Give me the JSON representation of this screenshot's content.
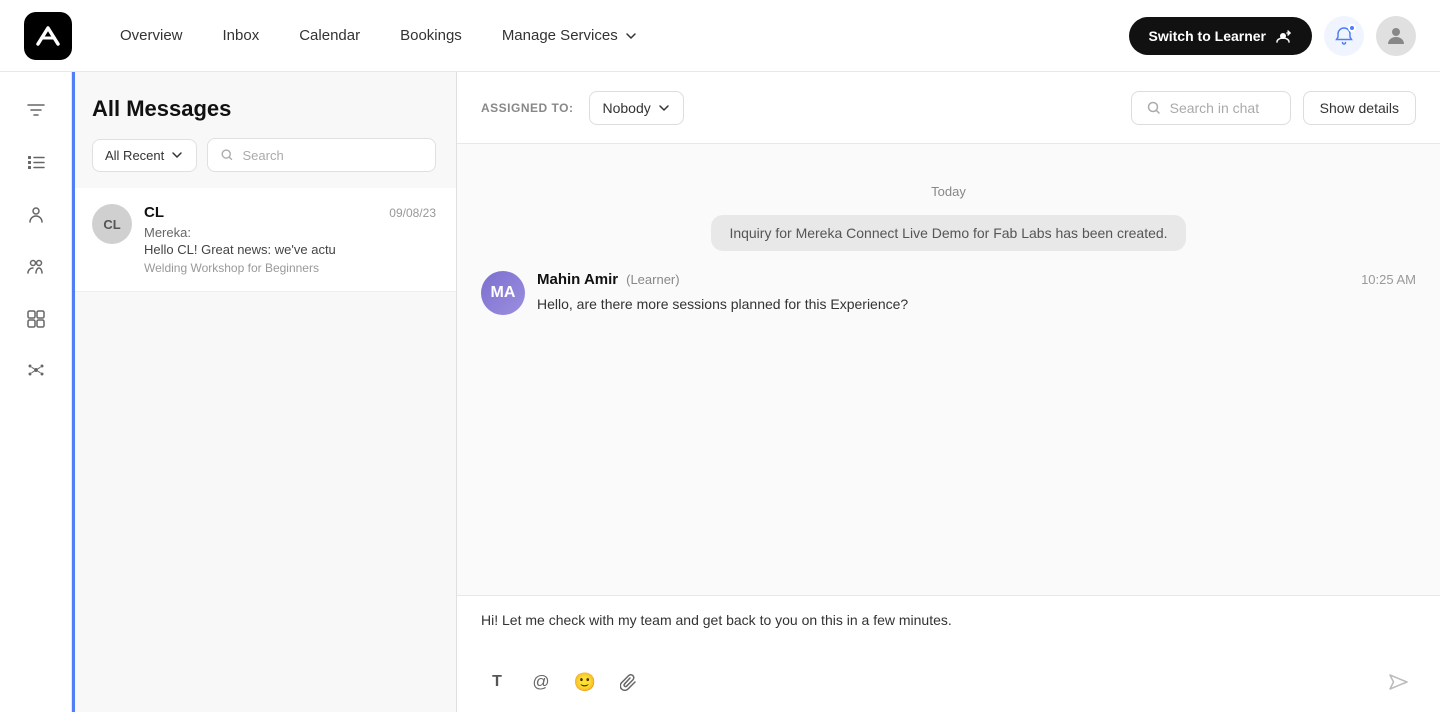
{
  "nav": {
    "overview": "Overview",
    "inbox": "Inbox",
    "calendar": "Calendar",
    "bookings": "Bookings",
    "manage_services": "Manage Services",
    "switch_to_learner": "Switch to Learner"
  },
  "sidebar": {
    "icons": [
      {
        "name": "filter-icon",
        "label": "Filters"
      },
      {
        "name": "list-icon",
        "label": "List"
      },
      {
        "name": "person-icon",
        "label": "Person"
      },
      {
        "name": "group-icon",
        "label": "Group"
      },
      {
        "name": "queue-icon",
        "label": "Queue"
      },
      {
        "name": "molecule-icon",
        "label": "Molecule"
      }
    ]
  },
  "messages_panel": {
    "title": "All Messages",
    "filter_label": "All Recent",
    "search_placeholder": "Search",
    "messages": [
      {
        "initials": "CL",
        "sender": "CL",
        "date": "09/08/23",
        "from": "Mereka:",
        "preview": "Hello CL! Great news: we've actu",
        "subject": "Welding Workshop for Beginners"
      }
    ]
  },
  "chat": {
    "assigned_label": "ASSIGNED TO:",
    "assigned_value": "Nobody",
    "search_chat_placeholder": "Search in chat",
    "show_details_label": "Show details",
    "date_separator": "Today",
    "system_message": "Inquiry for Mereka Connect Live Demo for Fab Labs has been created.",
    "messages": [
      {
        "sender": "Mahin Amir",
        "role": "(Learner)",
        "time": "10:25 AM",
        "text": "Hello, are there more sessions planned for this Experience?",
        "initials": "MA"
      }
    ],
    "input_draft": "Hi! Let me check with my team and get back to you on this in a few minutes."
  }
}
